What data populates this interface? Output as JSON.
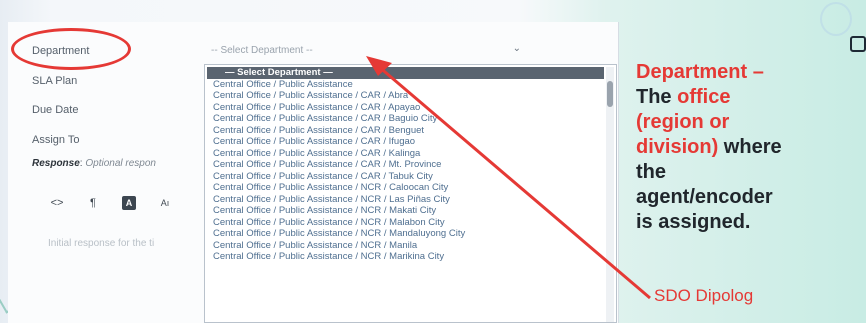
{
  "form": {
    "labels": {
      "department": "Department",
      "sla_plan": "SLA Plan",
      "due_date": "Due Date",
      "assign_to": "Assign To"
    },
    "department_select": {
      "value": "-- Select Department --"
    },
    "response": {
      "label": "Response",
      "hint": "Optional respon"
    },
    "toolbar": {
      "code_icon": "<>",
      "paragraph_icon": "¶",
      "text_color_icon": "A",
      "font_size_icon": "Aı"
    },
    "editor_placeholder": "Initial response for the ti"
  },
  "dropdown": {
    "options": [
      "— Select Department —",
      "Central Office / Public Assistance",
      "Central Office / Public Assistance / CAR / Abra",
      "Central Office / Public Assistance / CAR / Apayao",
      "Central Office / Public Assistance / CAR / Baguio City",
      "Central Office / Public Assistance / CAR / Benguet",
      "Central Office / Public Assistance / CAR / Ifugao",
      "Central Office / Public Assistance / CAR / Kalinga",
      "Central Office / Public Assistance / CAR / Mt. Province",
      "Central Office / Public Assistance / CAR / Tabuk City",
      "Central Office / Public Assistance / NCR / Caloocan City",
      "Central Office / Public Assistance / NCR / Las Piñas City",
      "Central Office / Public Assistance / NCR / Makati City",
      "Central Office / Public Assistance / NCR / Malabon City",
      "Central Office / Public Assistance / NCR / Mandaluyong City",
      "Central Office / Public Assistance / NCR / Manila",
      "Central Office / Public Assistance / NCR / Marikina City"
    ]
  },
  "annotation": {
    "title": "Department –",
    "line1_pre": "The ",
    "line1_red": "office",
    "line2_red": "(region or",
    "line3_red": "division)",
    "line3_post": " where",
    "line4": "the",
    "line5": "agent/encoder",
    "line6": "is assigned.",
    "credit": "SDO Dipolog"
  },
  "colors": {
    "accent_red": "#e53935",
    "option_text": "#4f6f90",
    "selected_bg": "#5a6470"
  }
}
